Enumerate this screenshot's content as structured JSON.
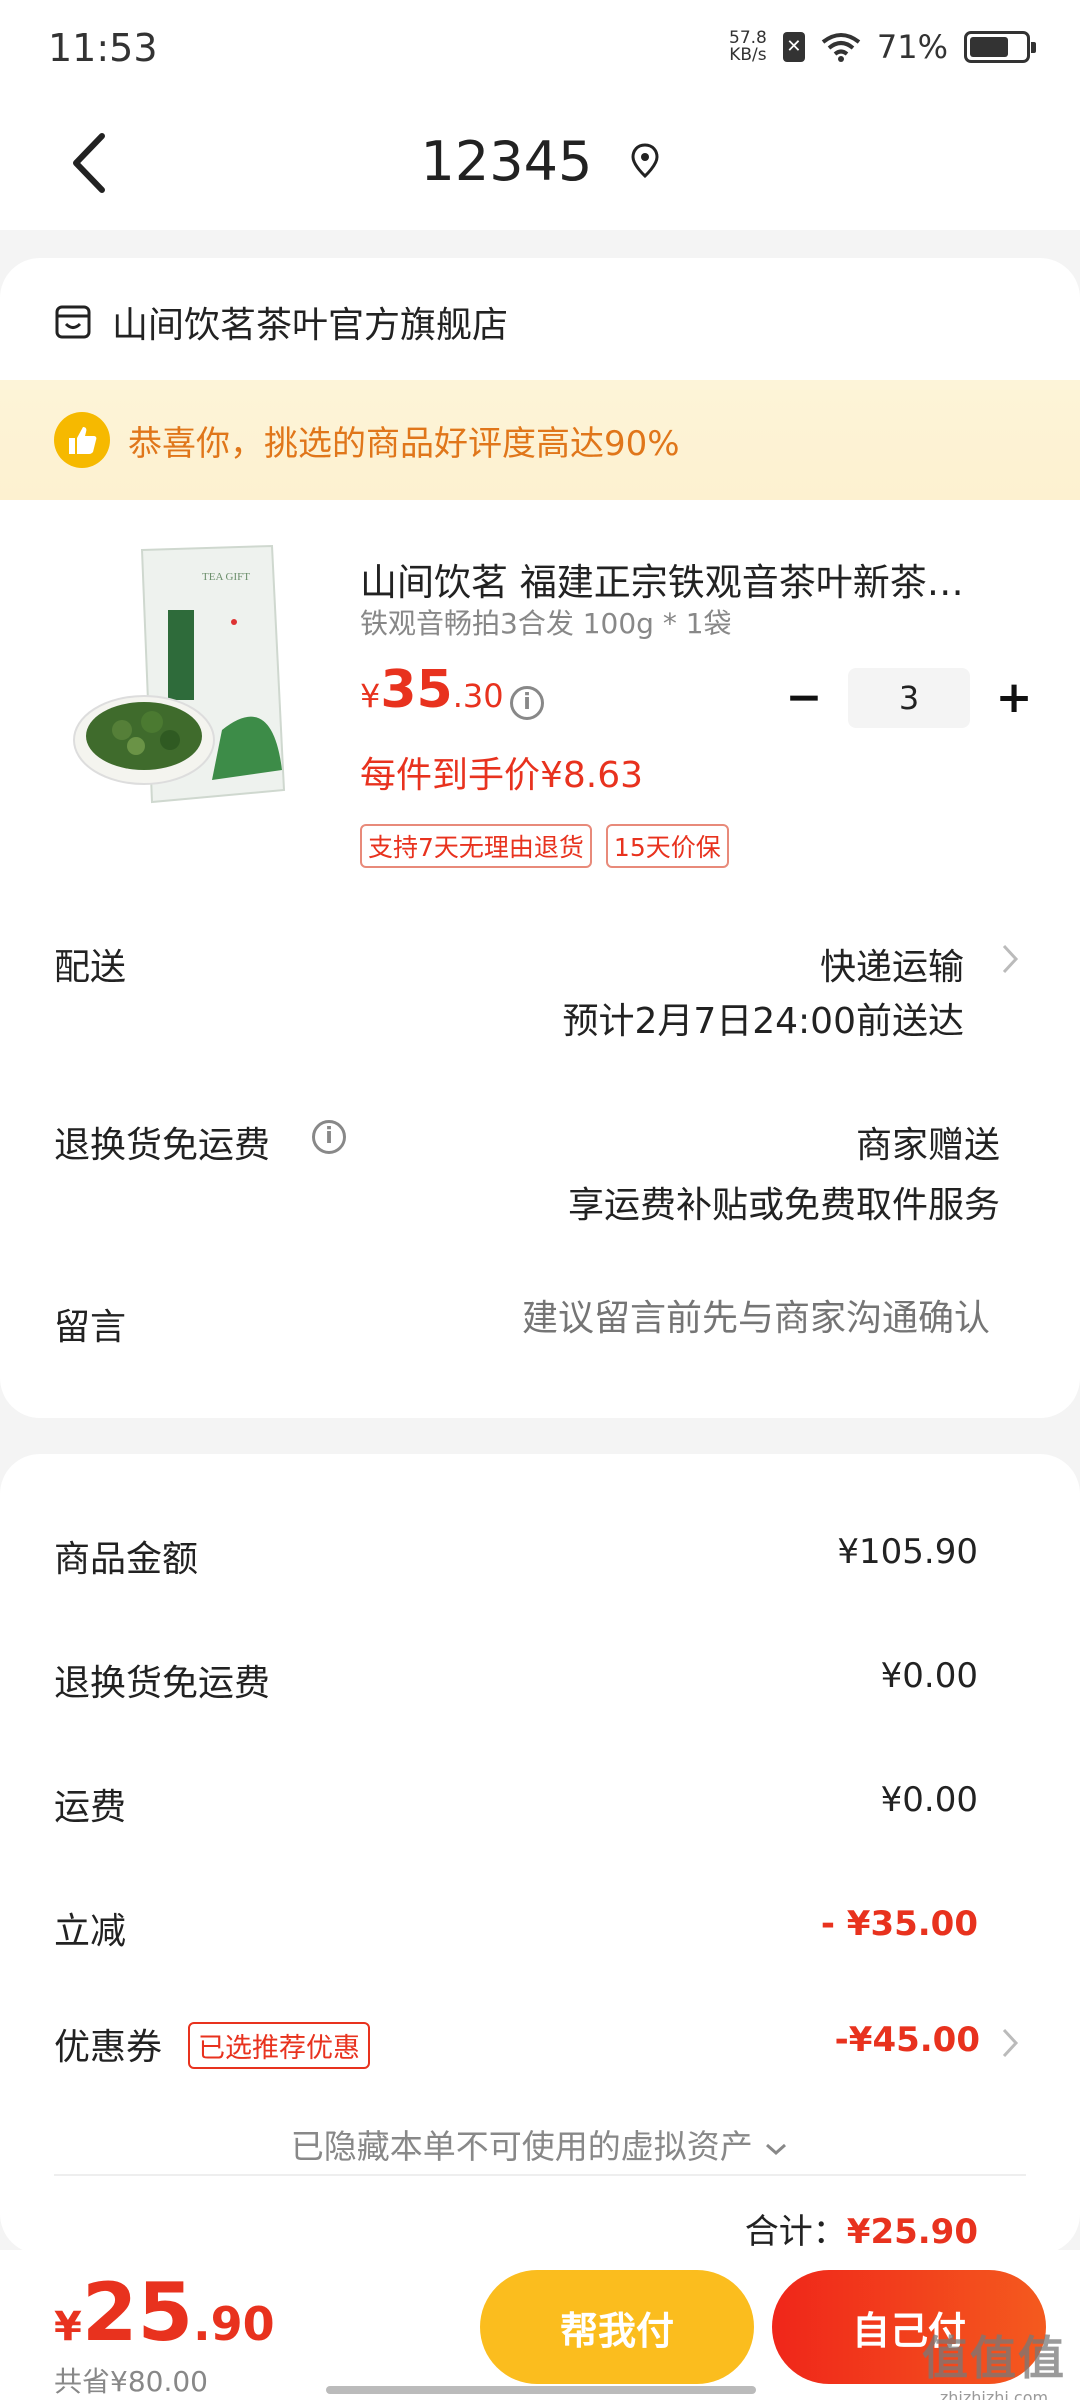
{
  "status_bar": {
    "time": "11:53",
    "net_speed_top": "57.8",
    "net_speed_bottom": "KB/s",
    "battery": "71%",
    "battery_level": 0.71
  },
  "header": {
    "title": "12345"
  },
  "store": {
    "name": "山间饮茗茶叶官方旗舰店"
  },
  "promo": {
    "text": "恭喜你，挑选的商品好评度高达90%"
  },
  "product": {
    "title": "山间饮茗 福建正宗铁观音茶叶新茶浓香型乌龙茶",
    "spec": "铁观音畅拍3合发 100g * 1袋",
    "price_currency": "¥",
    "price_int": "35",
    "price_dec": ".30",
    "quantity": "3",
    "unit_price": "每件到手价¥8.63",
    "tags": [
      "支持7天无理由退货",
      "15天价保"
    ],
    "bag_label": "TEA GIFT"
  },
  "delivery": {
    "label": "配送",
    "method": "快递运输",
    "eta": "预计2月7日24:00前送达"
  },
  "return_shipping": {
    "label": "退换货免运费",
    "value": "商家赠送",
    "sub": "享运费补贴或免费取件服务"
  },
  "message": {
    "label": "留言",
    "placeholder": "建议留言前先与商家沟通确认"
  },
  "summary": {
    "goods_amount_label": "商品金额",
    "goods_amount": "¥105.90",
    "return_fee_label": "退换货免运费",
    "return_fee": "¥0.00",
    "shipping_label": "运费",
    "shipping": "¥0.00",
    "discount_label": "立减",
    "discount": "- ¥35.00",
    "coupon_label": "优惠券",
    "coupon_tag": "已选推荐优惠",
    "coupon": "-¥45.00",
    "hidden_assets": "已隐藏本单不可使用的虚拟资产",
    "total_label": "合计：",
    "total": "¥25.90"
  },
  "bottom_bar": {
    "currency": "¥",
    "price_int": "25",
    "price_dec": ".90",
    "saved": "共省¥80.00",
    "help_pay": "帮我付",
    "self_pay": "自己付"
  },
  "watermark": {
    "big": "值值值",
    "small": "zhizhizhi.com"
  },
  "colors": {
    "accent_red": "#e8321e",
    "accent_yellow": "#fbbd1e",
    "promo_orange": "#e0761a"
  }
}
